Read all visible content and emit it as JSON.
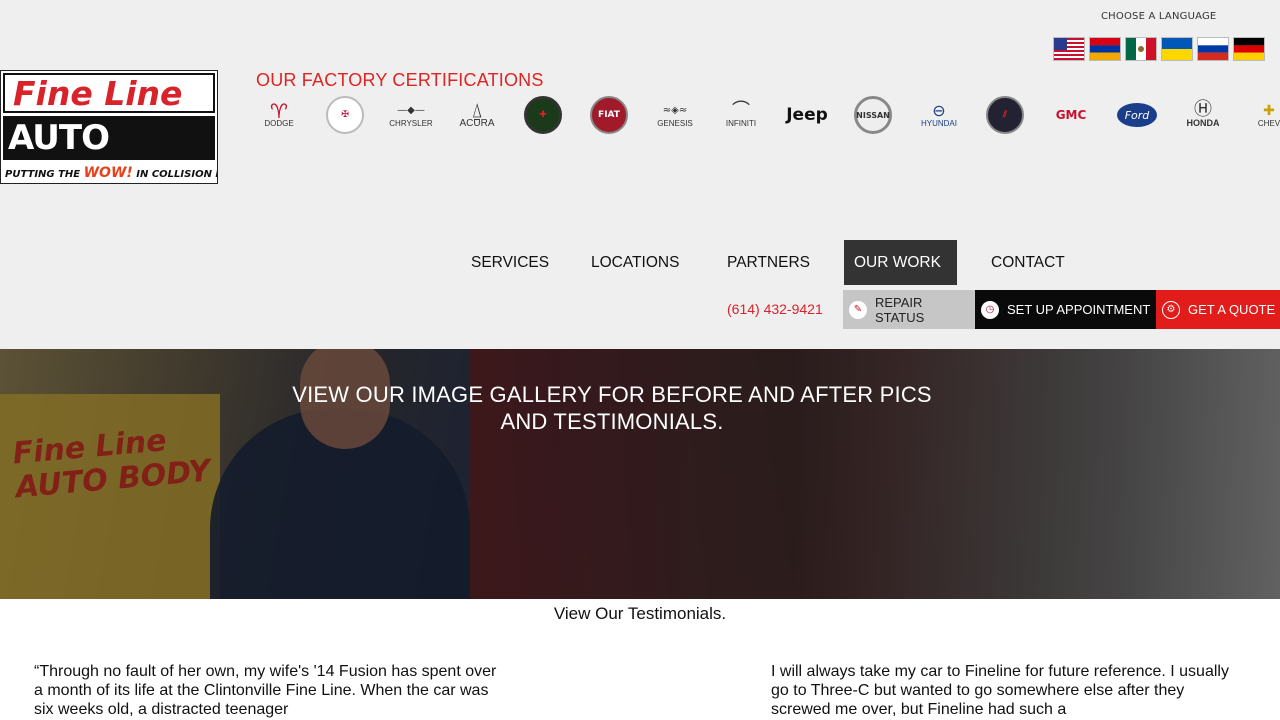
{
  "language": {
    "label": "CHOOSE A LANGUAGE",
    "flags": [
      "us-flag-icon",
      "armenia-flag-icon",
      "mexico-flag-icon",
      "ukraine-flag-icon",
      "russia-flag-icon",
      "germany-flag-icon"
    ]
  },
  "logo": {
    "line1": "Fine Line",
    "line2": "AUTO BODY",
    "tag_pre": "PUTTING THE",
    "tag_wow": "WOW!",
    "tag_post": "IN COLLISION REPAIR"
  },
  "certifications": {
    "title": "OUR FACTORY CERTIFICATIONS",
    "brands": [
      {
        "name": "DODGE",
        "icon": "ram-icon"
      },
      {
        "name": "",
        "icon": "cadillac-icon"
      },
      {
        "name": "CHRYSLER",
        "icon": "chrysler-wings-icon"
      },
      {
        "name": "ACURA",
        "icon": "acura-icon"
      },
      {
        "name": "",
        "icon": "alfa-romeo-icon"
      },
      {
        "name": "FIAT",
        "icon": "fiat-icon"
      },
      {
        "name": "GENESIS",
        "icon": "genesis-wings-icon"
      },
      {
        "name": "INFINITI",
        "icon": "infiniti-icon"
      },
      {
        "name": "Jeep",
        "icon": "jeep-wordmark"
      },
      {
        "name": "NISSAN",
        "icon": "nissan-icon"
      },
      {
        "name": "HYUNDAI",
        "icon": "hyundai-icon"
      },
      {
        "name": "",
        "icon": "buick-icon"
      },
      {
        "name": "GMC",
        "icon": "gmc-wordmark"
      },
      {
        "name": "Ford",
        "icon": "ford-icon"
      },
      {
        "name": "HONDA",
        "icon": "honda-icon"
      },
      {
        "name": "CHEV",
        "icon": "chevrolet-icon"
      }
    ]
  },
  "nav": {
    "items": [
      "SERVICES",
      "LOCATIONS",
      "PARTNERS",
      "OUR WORK",
      "CONTACT"
    ],
    "active": "OUR WORK"
  },
  "contact": {
    "phone": "(614) 432-9421",
    "repair_status": "REPAIR STATUS",
    "appointment": "SET UP APPOINTMENT",
    "quote": "GET A QUOTE"
  },
  "hero": {
    "line1": "VIEW OUR IMAGE GALLERY FOR BEFORE AND AFTER PICS",
    "line2": "AND TESTIMONIALS.",
    "cabinet_line1": "Fine Line",
    "cabinet_line2": "AUTO BODY"
  },
  "testimonials": {
    "title": "View Our Testimonials.",
    "left": "“Through no fault of her own, my wife's '14 Fusion has spent over a month of its life at the Clintonville Fine Line. When the car was six weeks old, a distracted teenager",
    "right": "I will always take my car to Fineline for future reference. I usually go to Three-C but wanted to go somewhere else after they screwed me over, but Fineline had such a"
  },
  "colors": {
    "accent_red": "#e02424",
    "header_bg": "#efefef",
    "active_nav": "#333333",
    "quote_bg": "#e21b1b"
  }
}
